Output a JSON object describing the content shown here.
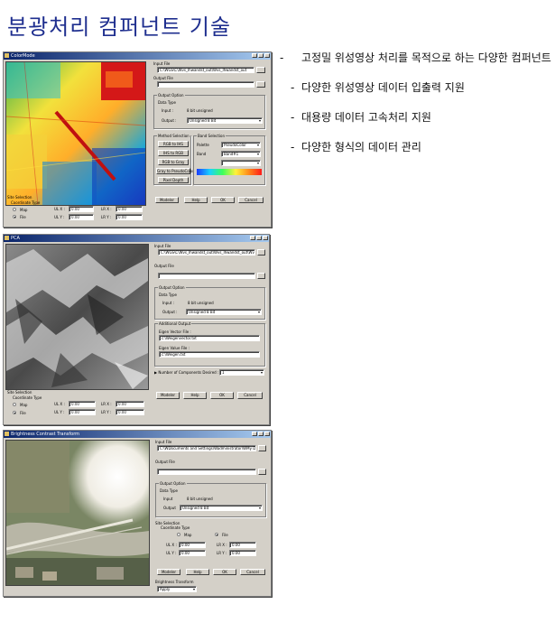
{
  "page": {
    "title": "분광처리 컴퍼넌트 기술",
    "bullets": [
      "고정밀 위성영상 처리를 목적으로 하는 다양한 컴퍼넌트",
      "다양한 위성영상 데이터 입출력 지원",
      "대용량 데이터 고속처리 지원",
      "다양한 형식의 데이터 관리"
    ],
    "bullet_dash": "-"
  },
  "win1": {
    "title": "ColorMode",
    "input_file_label": "Input File",
    "input_file_value": "C:\\WGS\\C\\Wvs_Ihwandst_out\\Wvs_Ihwandst_out",
    "output_file_label": "Output File",
    "output_option_label": "Output Option",
    "data_type_label": "Data Type",
    "input_label": "Input :",
    "input_value": "8 bit unsigned",
    "output_label": "Output :",
    "output_value": "Unsigned 8 Bit",
    "method_label": "Method Selection",
    "methods": [
      "RGB to IHS",
      "IHS to RGB",
      "RGB to Gray",
      "Gray to PseudoColor",
      "Pixel Depth"
    ],
    "band_selection_label": "Band Selection",
    "palette_label": "Palette",
    "palette_value": "PseudoColor",
    "band_label": "Band",
    "band_value": "Band#1",
    "site_label": "Site Selection",
    "coord_label": "Coordinate Type",
    "map_label": "Map",
    "file_label": "File",
    "ulx": "UL X :",
    "uly": "UL Y :",
    "lrx": "LR X :",
    "lry": "LR Y :",
    "zero": "0.00",
    "modeler": "Modeler",
    "help": "Help",
    "ok": "OK",
    "cancel": "Cancel"
  },
  "win2": {
    "title": "PCA",
    "input_file_label": "Input File",
    "input_file_value": "C:\\WGS\\C\\Wvs_Ihwandst_out\\Wvs_Ihwandst_out\\Wvs_Ihw",
    "output_file_label": "Output File",
    "output_option_label": "Output Option",
    "data_type_label": "Data Type",
    "input_label": "Input :",
    "input_value": "8 bit unsigned",
    "output_label": "Output :",
    "output_value": "Unsigned 8 Bit",
    "additional_label": "Additional Output",
    "eigen_vector_label": "Eigen Vector File :",
    "eigen_vector_value": "c:\\Weigenvector.txt",
    "eigen_value_label": "Eigen Value File :",
    "eigen_value_value": "c:\\Weigen.txt",
    "components_label": "Number of Components Desired :",
    "components_value": "1",
    "site_label": "Site Selection",
    "coord_label": "Coordinate Type",
    "map_label": "Map",
    "file_label": "File",
    "ulx": "UL X :",
    "uly": "UL Y :",
    "lrx": "LR X :",
    "lry": "LR Y :",
    "zero": "0.00",
    "modeler": "Modeler",
    "help": "Help",
    "ok": "OK",
    "cancel": "Cancel"
  },
  "win3": {
    "title": "Brightness Contrast Transform",
    "input_file_label": "Input File",
    "input_file_value": "C:\\WDocuments and Settings\\Wadministrator\\WMy Documents\\WR",
    "output_file_label": "Output File",
    "output_option_label": "Output Option",
    "data_type_label": "Data Type",
    "input_label": "Input",
    "input_value": "8 bit unsigned",
    "output_label": "Output",
    "output_value": "Unsigned 8 Bit",
    "site_label": "Site Selection",
    "coord_label": "Coordinate Type",
    "map_label": "Map",
    "file_label": "File",
    "ulx": "UL X :",
    "uly": "UL Y :",
    "lrx": "LR X :",
    "lry": "LR Y :",
    "zero": "0.00",
    "modeler": "Modeler",
    "help": "Help",
    "ok": "OK",
    "cancel": "Cancel",
    "bc_label": "Brightness Transform",
    "bc_value": "Apply"
  }
}
